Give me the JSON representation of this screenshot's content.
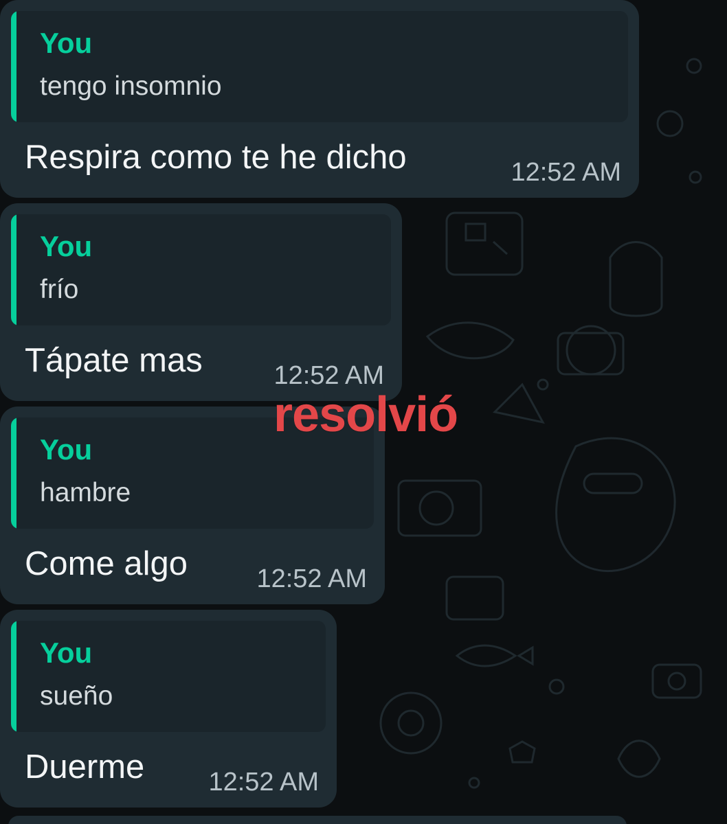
{
  "conversation": {
    "messages": [
      {
        "quote_author": "You",
        "quote_text": "tengo insomnio",
        "reply": "Respira como te he dicho",
        "time": "12:52 AM"
      },
      {
        "quote_author": "You",
        "quote_text": "frío",
        "reply": "Tápate mas",
        "time": "12:52 AM"
      },
      {
        "quote_author": "You",
        "quote_text": "hambre",
        "reply": "Come algo",
        "time": "12:52 AM"
      },
      {
        "quote_author": "You",
        "quote_text": "sueño",
        "reply": "Duerme",
        "time": "12:52 AM"
      }
    ]
  },
  "overlay": {
    "text": "resolvió"
  },
  "colors": {
    "background": "#0c0f11",
    "bubble": "#1f2c33",
    "quote_accent": "#06cf9c",
    "overlay_text": "#e34749"
  }
}
